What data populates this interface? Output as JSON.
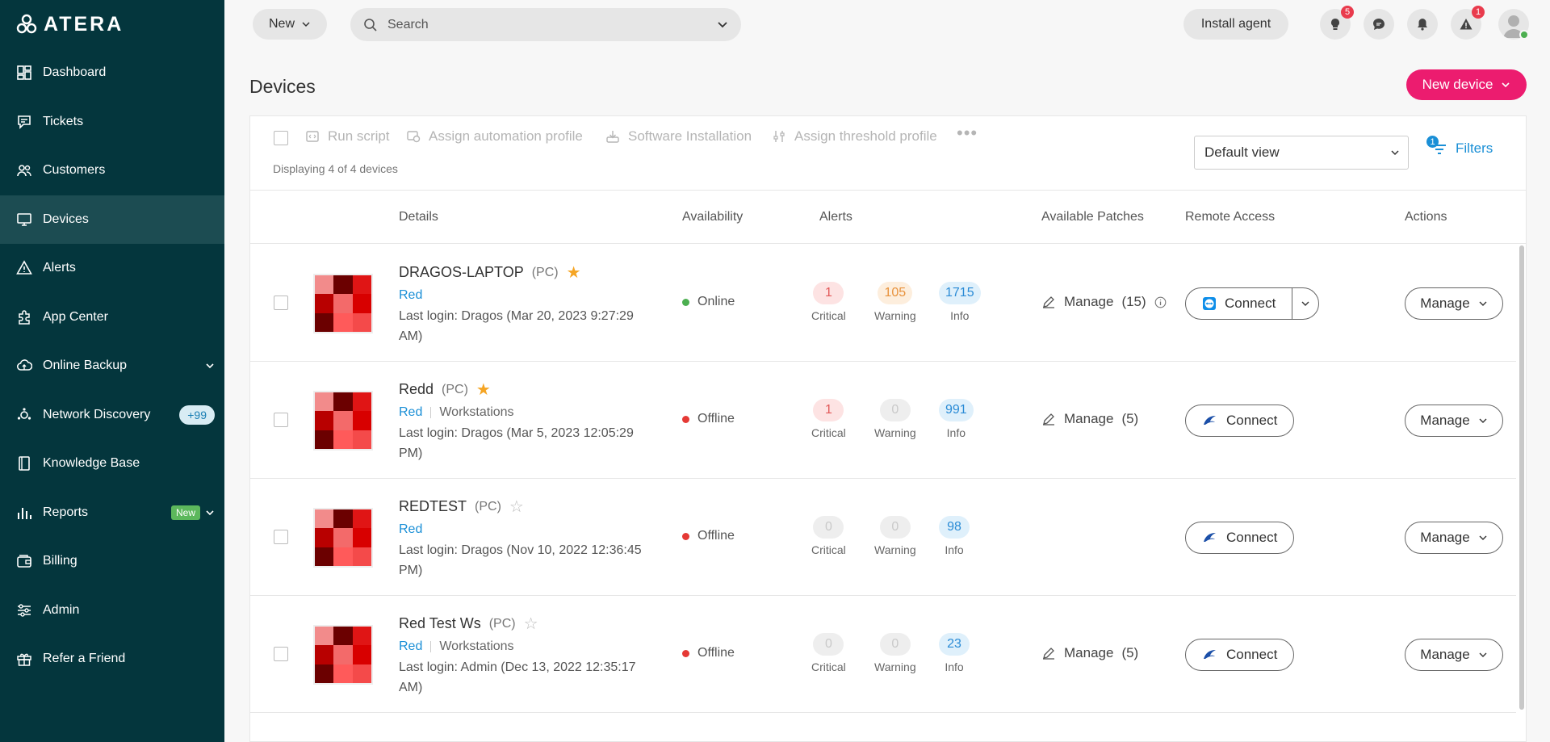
{
  "brand": {
    "name": "ATERA"
  },
  "sidebar": {
    "items": [
      {
        "label": "Dashboard",
        "icon": "dashboard-icon"
      },
      {
        "label": "Tickets",
        "icon": "tickets-icon"
      },
      {
        "label": "Customers",
        "icon": "customers-icon"
      },
      {
        "label": "Devices",
        "icon": "devices-icon",
        "active": true
      },
      {
        "label": "Alerts",
        "icon": "alerts-icon"
      },
      {
        "label": "App Center",
        "icon": "app-center-icon"
      },
      {
        "label": "Online Backup",
        "icon": "backup-icon",
        "has_chevron": true
      },
      {
        "label": "Network Discovery",
        "icon": "network-icon",
        "badge": "+99"
      },
      {
        "label": "Knowledge Base",
        "icon": "knowledge-icon"
      },
      {
        "label": "Reports",
        "icon": "reports-icon",
        "new_badge": "New",
        "has_chevron": true
      },
      {
        "label": "Billing",
        "icon": "billing-icon"
      },
      {
        "label": "Admin",
        "icon": "admin-icon"
      },
      {
        "label": "Refer a Friend",
        "icon": "gift-icon"
      }
    ]
  },
  "topbar": {
    "new_label": "New",
    "search_placeholder": "Search",
    "install_label": "Install agent",
    "tips_count": "5",
    "warnings_count": "1"
  },
  "page": {
    "title": "Devices",
    "new_device_label": "New device"
  },
  "toolbar": {
    "actions": [
      "Run script",
      "Assign automation profile",
      "Software Installation",
      "Assign threshold profile"
    ],
    "displaying": "Displaying 4 of 4 devices",
    "view": "Default view",
    "filters_label": "Filters",
    "filters_count": "1"
  },
  "table": {
    "headers": {
      "details": "Details",
      "availability": "Availability",
      "alerts": "Alerts",
      "patches": "Available Patches",
      "remote": "Remote Access",
      "actions": "Actions"
    },
    "alert_labels": {
      "critical": "Critical",
      "warning": "Warning",
      "info": "Info"
    },
    "manage_label": "Manage",
    "connect_label": "Connect",
    "rows": [
      {
        "name": "DRAGOS-LAPTOP",
        "type": "(PC)",
        "starred": true,
        "customer": "Red",
        "folder": "",
        "login": "Last login: Dragos (Mar 20, 2023 9:27:29 AM)",
        "status": "Online",
        "status_color": "#4caf50",
        "critical": "1",
        "warning": "105",
        "info": "1715",
        "patches": "(15)",
        "patch_info": true,
        "remote": "teamviewer"
      },
      {
        "name": "Redd",
        "type": "(PC)",
        "starred": true,
        "customer": "Red",
        "folder": "Workstations",
        "login": "Last login: Dragos (Mar 5, 2023 12:05:29 PM)",
        "status": "Offline",
        "status_color": "#e53935",
        "critical": "1",
        "warning": "0",
        "info": "991",
        "patches": "(5)",
        "patch_info": false,
        "remote": "splashtop"
      },
      {
        "name": "REDTEST",
        "type": "(PC)",
        "starred": false,
        "customer": "Red",
        "folder": "",
        "login": "Last login: Dragos (Nov 10, 2022 12:36:45 PM)",
        "status": "Offline",
        "status_color": "#e53935",
        "critical": "0",
        "warning": "0",
        "info": "98",
        "patches": "",
        "patch_info": false,
        "remote": "splashtop"
      },
      {
        "name": "Red Test Ws",
        "type": "(PC)",
        "starred": false,
        "customer": "Red",
        "folder": "Workstations",
        "login": "Last login: Admin (Dec 13, 2022 12:35:17 AM)",
        "status": "Offline",
        "status_color": "#e53935",
        "critical": "0",
        "warning": "0",
        "info": "23",
        "patches": "(5)",
        "patch_info": false,
        "remote": "splashtop"
      }
    ]
  },
  "colors": {
    "sidebar_bg": "#04363d",
    "accent_pink": "#ec1c6f",
    "link_blue": "#1a8fd6"
  }
}
